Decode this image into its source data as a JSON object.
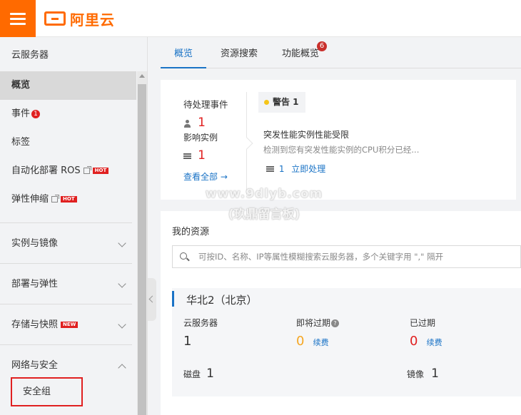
{
  "header": {
    "logo_text": "阿里云"
  },
  "sidebar": {
    "title": "云服务器",
    "items": [
      {
        "label": "概览"
      },
      {
        "label": "事件",
        "badge": "1"
      },
      {
        "label": "标签"
      },
      {
        "label": "自动化部署 ROS",
        "tag": "HOT"
      },
      {
        "label": "弹性伸缩",
        "tag": "HOT"
      }
    ],
    "groups": [
      {
        "label": "实例与镜像"
      },
      {
        "label": "部署与弹性"
      },
      {
        "label": "存储与快照",
        "tag": "NEW"
      },
      {
        "label": "网络与安全"
      }
    ],
    "sub_item": "安全组"
  },
  "tabs": [
    {
      "label": "概览"
    },
    {
      "label": "资源搜索"
    },
    {
      "label": "功能概览",
      "badge": "6"
    }
  ],
  "events": {
    "pending_title": "待处理事件",
    "pending_count": "1",
    "affected_label": "影响实例",
    "affected_count": "1",
    "view_all": "查看全部 →",
    "warning_label": "警告 1",
    "event_title": "突发性能实例性能受限",
    "event_desc": "检测到您有突发性能实例的CPU积分已经...",
    "event_count": "1",
    "handle_link": "立即处理"
  },
  "resources": {
    "title": "我的资源",
    "search_placeholder": "可按ID、名称、IP等属性模糊搜索云服务器，多个关键字用 \",\" 隔开",
    "region": "华北2（北京）",
    "servers_label": "云服务器",
    "servers_value": "1",
    "expiring_label": "即将过期",
    "expiring_value": "0",
    "renew_label": "续费",
    "expired_label": "已过期",
    "expired_value": "0",
    "disk_label": "磁盘",
    "disk_value": "1",
    "image_label": "镜像",
    "image_value": "1"
  },
  "watermark": {
    "line1": "www.9dlyb.com",
    "line2": "(玖鼎留言板)"
  },
  "colors": {
    "brand": "#ff6a00",
    "accent": "#1a73c6",
    "danger": "#e02020",
    "warning": "#f5a623"
  }
}
